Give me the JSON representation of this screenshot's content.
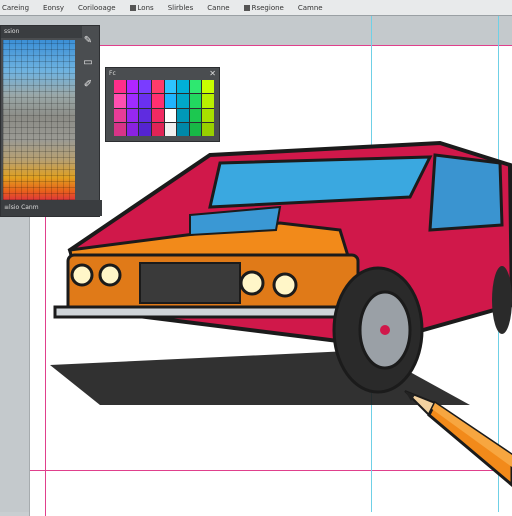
{
  "menubar": {
    "items": [
      {
        "label": "Careing"
      },
      {
        "label": "Eonsy"
      },
      {
        "label": "Corilooage"
      },
      {
        "label": "Lons"
      },
      {
        "label": "Slirbles"
      },
      {
        "label": "Canne"
      },
      {
        "label": "Rsegione"
      },
      {
        "label": "Camne"
      }
    ]
  },
  "layers_panel": {
    "title": "ssion",
    "footer": "≡lsio  Canm",
    "colors": [
      "#3b8fd6",
      "#9aa8a8",
      "#e0a020",
      "#d8204c"
    ]
  },
  "swatch_panel": {
    "title": "Fc",
    "colors": [
      "#ff2e8a",
      "#b026ff",
      "#7a3cff",
      "#ff3c6a",
      "#2ec4ff",
      "#00b0d8",
      "#2ee870",
      "#c8ff00",
      "#ff4fb0",
      "#a02cff",
      "#6a30f0",
      "#ff3070",
      "#20b4ff",
      "#00a8c8",
      "#22d860",
      "#b8f000",
      "#e83c98",
      "#9628f0",
      "#5f2ce0",
      "#f02a62",
      "#ffffff",
      "#0098b8",
      "#1cc850",
      "#a8e000",
      "#d83488",
      "#8a22e0",
      "#5424d0",
      "#e02456",
      "#f0f0f0",
      "#0088a8",
      "#18b846",
      "#98d000"
    ]
  },
  "car": {
    "colors": {
      "body_orange": "#f28a1a",
      "body_magenta": "#d0184a",
      "windshield": "#3aa8e0",
      "outline": "#1b1b1b"
    }
  }
}
